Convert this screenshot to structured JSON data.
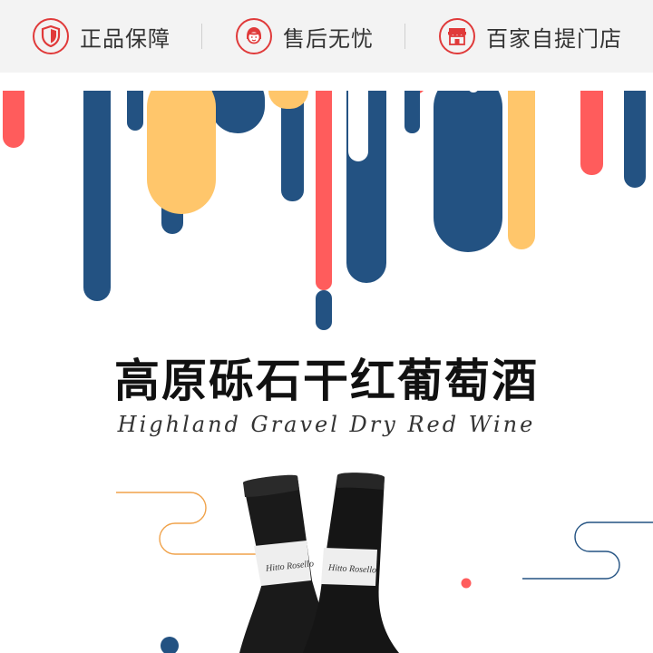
{
  "features": [
    {
      "label": "正品保障",
      "icon": "shield-icon"
    },
    {
      "label": "售后无忧",
      "icon": "service-person-icon"
    },
    {
      "label": "百家自提门店",
      "icon": "store-icon"
    }
  ],
  "title_cn": "高原砾石干红葡萄酒",
  "title_en": "Highland Gravel Dry Red Wine",
  "bottle_label": "Hitto Rosello",
  "colors": {
    "accent_red": "#e03a3a",
    "drip_blue": "#235282",
    "drip_yellow": "#ffc66b",
    "drip_coral": "#ff5c5c",
    "topbar_bg": "#f3f3f3"
  }
}
